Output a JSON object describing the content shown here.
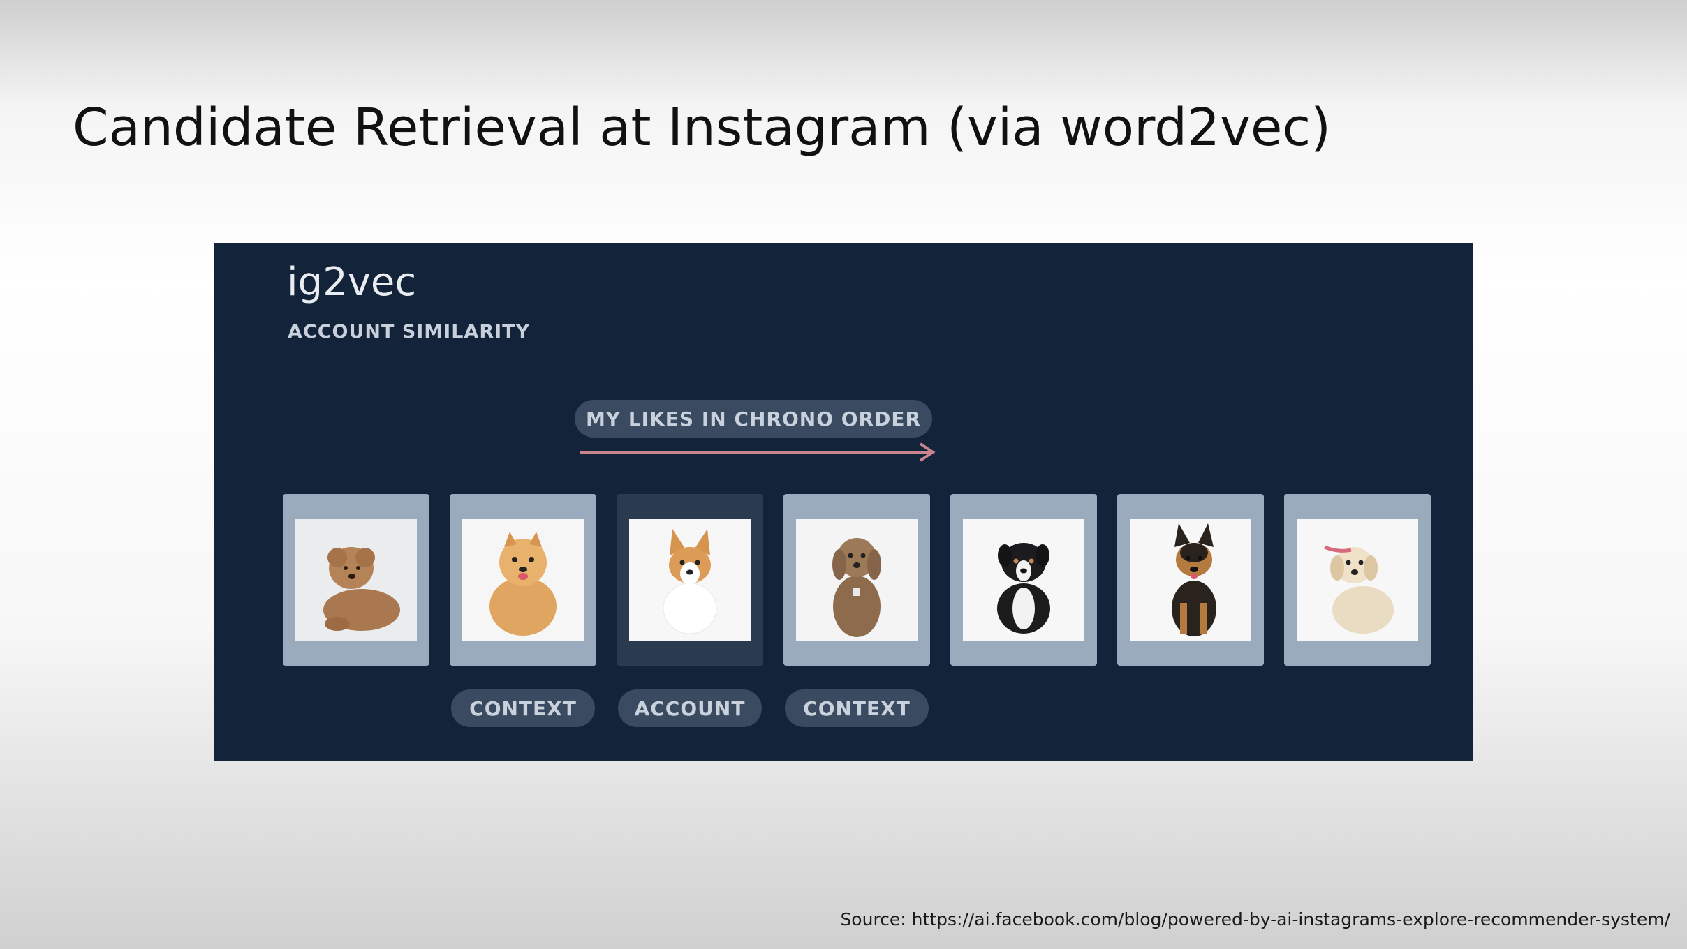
{
  "slide": {
    "title": "Candidate Retrieval at Instagram (via word2vec)",
    "source": "Source: https://ai.facebook.com/blog/powered-by-ai-instagrams-explore-recommender-system/"
  },
  "panel": {
    "title": "ig2vec",
    "subtitle": "ACCOUNT SIMILARITY",
    "sequence_label": "MY LIKES IN CHRONO ORDER",
    "arrow_color": "#c9848e",
    "background_color": "#13233a",
    "cards": [
      {
        "subject": "brown-poodle-puppy",
        "highlighted": false
      },
      {
        "subject": "pomeranian",
        "highlighted": false
      },
      {
        "subject": "corgi",
        "highlighted": true
      },
      {
        "subject": "cockapoo",
        "highlighted": false
      },
      {
        "subject": "border-collie-puppy",
        "highlighted": false
      },
      {
        "subject": "german-shepherd-puppy",
        "highlighted": false
      },
      {
        "subject": "golden-retriever-puppy",
        "highlighted": false
      }
    ],
    "role_labels": [
      "CONTEXT",
      "ACCOUNT",
      "CONTEXT"
    ]
  }
}
